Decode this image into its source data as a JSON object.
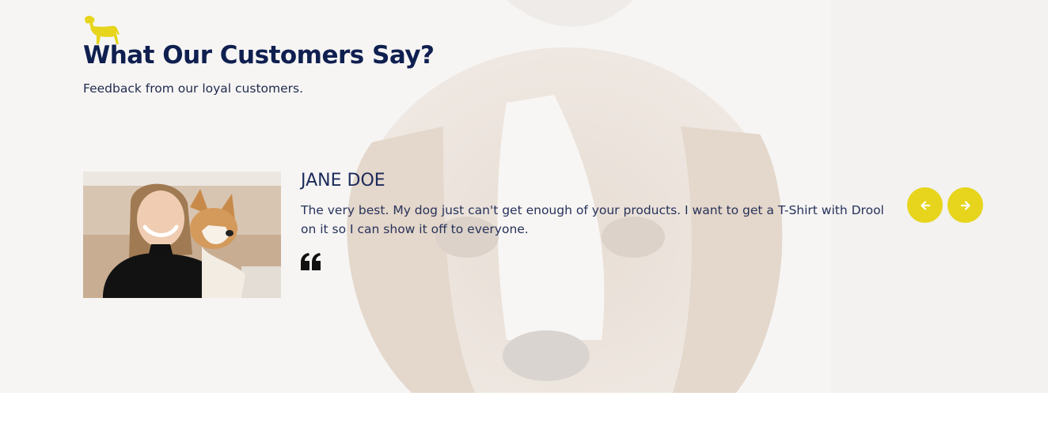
{
  "section": {
    "logo_icon": "dog-icon",
    "title": "What Our Customers Say?",
    "subtitle": "Feedback from our loyal customers."
  },
  "testimonial": {
    "photo_icon": "customer-photo",
    "name": "JANE DOE",
    "quote": "The very best. My dog just can't get enough of your products. I want to get a T-Shirt with Drool on it so I can show it off to everyone.",
    "quote_icon": "quote-icon"
  },
  "controls": {
    "prev_icon": "arrow-left-icon",
    "next_icon": "arrow-right-icon"
  },
  "colors": {
    "accent": "#e6d51c",
    "heading": "#0f1f4f",
    "text": "#27325a",
    "section_bg": "#f5f4f3"
  }
}
